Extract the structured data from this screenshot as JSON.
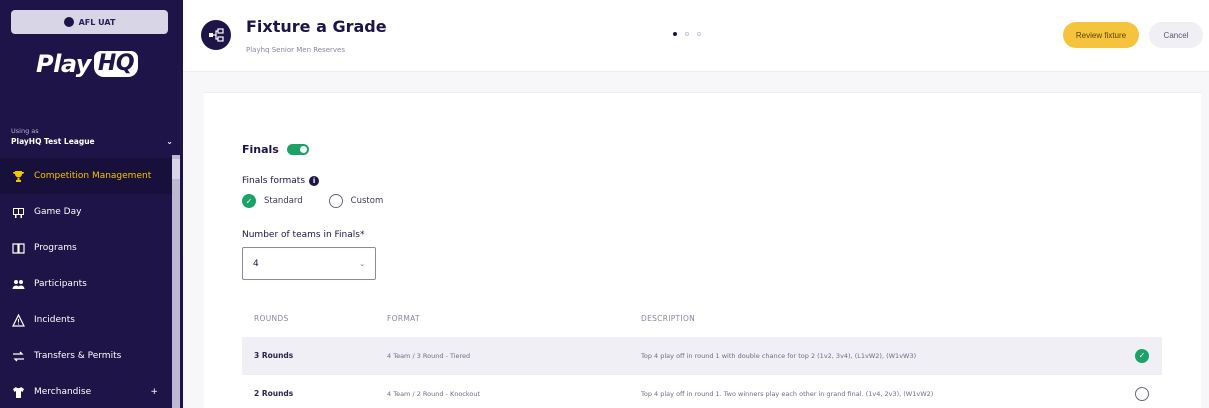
{
  "sidebar": {
    "env_badge": "AFL UAT",
    "logo": {
      "text": "Play",
      "mark": "HQ"
    },
    "using_label": "Using as",
    "org_name": "PlayHQ Test League",
    "nav": [
      {
        "label": "Competition Management",
        "icon": "trophy-icon",
        "active": true
      },
      {
        "label": "Game Day",
        "icon": "scoreboard-icon",
        "active": false
      },
      {
        "label": "Programs",
        "icon": "book-icon",
        "active": false
      },
      {
        "label": "Participants",
        "icon": "people-icon",
        "active": false
      },
      {
        "label": "Incidents",
        "icon": "warning-icon",
        "active": false
      },
      {
        "label": "Transfers & Permits",
        "icon": "transfer-icon",
        "active": false
      },
      {
        "label": "Merchandise",
        "icon": "shirt-icon",
        "active": false,
        "has_more": true
      }
    ]
  },
  "header": {
    "title": "Fixture a Grade",
    "subtitle": "Playhq Senior Men Reserves",
    "steps": [
      true,
      false,
      false
    ],
    "review_label": "Review fixture",
    "cancel_label": "Cancel"
  },
  "form": {
    "finals_label": "Finals",
    "finals_enabled": true,
    "formats_label": "Finals formats",
    "format_options": [
      {
        "label": "Standard",
        "checked": true
      },
      {
        "label": "Custom",
        "checked": false
      }
    ],
    "teams_label": "Number of teams in Finals*",
    "teams_value": "4"
  },
  "table": {
    "headers": [
      "ROUNDS",
      "FORMAT",
      "DESCRIPTION"
    ],
    "rows": [
      {
        "rounds": "3 Rounds",
        "format": "4 Team / 3 Round - Tiered",
        "description": "Top 4 play off in round 1 with double chance for top 2 (1v2, 3v4), (L1vW2), (W1vW3)",
        "selected": true
      },
      {
        "rounds": "2 Rounds",
        "format": "4 Team / 2 Round - Knockout",
        "description": "Top 4 play off in round 1. Two winners play each other in grand final. (1v4, 2v3), (W1vW2)",
        "selected": false
      }
    ]
  },
  "colors": {
    "sidebar_bg": "#1f1447",
    "active_nav": "#f5c400",
    "primary_button": "#f6c33c",
    "success": "#1aa267"
  }
}
